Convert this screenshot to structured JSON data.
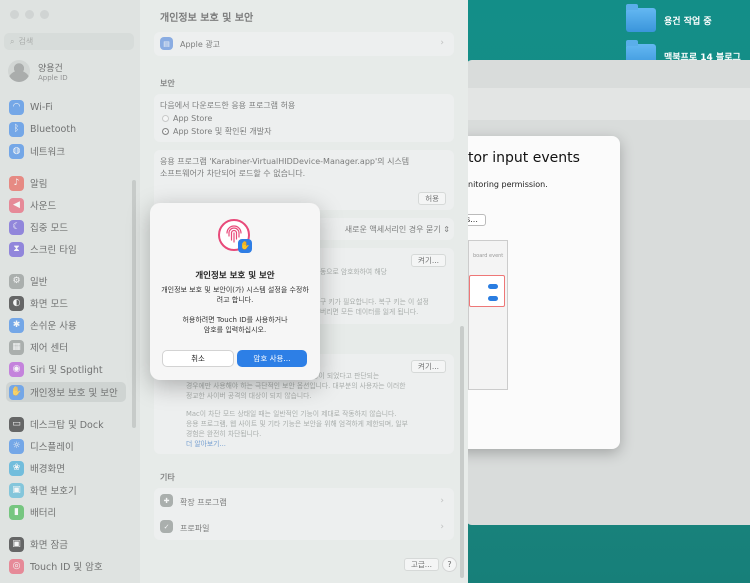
{
  "desktop": {
    "folders": [
      {
        "label": "용건 작업 중"
      },
      {
        "label": "맥북프로 14 블로그"
      }
    ]
  },
  "bg_dialog": {
    "title": "tor input events",
    "subtitle": "nitoring permission.",
    "button": "s...",
    "image_text": "board event"
  },
  "window": {
    "title": "개인정보 보호 및 보안"
  },
  "sidebar": {
    "search_placeholder": "검색",
    "user": {
      "name": "양용건",
      "sub": "Apple ID"
    },
    "items": [
      {
        "label": "Wi-Fi",
        "icon": "wifi-icon",
        "color": "#3a86e8"
      },
      {
        "label": "Bluetooth",
        "icon": "bluetooth-icon",
        "color": "#3a86e8"
      },
      {
        "label": "네트워크",
        "icon": "globe-icon",
        "color": "#3a86e8"
      },
      {
        "label": "알림",
        "icon": "bell-icon",
        "color": "#e85a4f"
      },
      {
        "label": "사운드",
        "icon": "speaker-icon",
        "color": "#e85a6f"
      },
      {
        "label": "집중 모드",
        "icon": "moon-icon",
        "color": "#6654d6"
      },
      {
        "label": "스크린 타임",
        "icon": "hourglass-icon",
        "color": "#6654d6"
      },
      {
        "label": "일반",
        "icon": "gear-icon",
        "color": "#8d9290"
      },
      {
        "label": "화면 모드",
        "icon": "appearance-icon",
        "color": "#222222"
      },
      {
        "label": "손쉬운 사용",
        "icon": "accessibility-icon",
        "color": "#3a86e8"
      },
      {
        "label": "제어 센터",
        "icon": "control-center-icon",
        "color": "#8d9290"
      },
      {
        "label": "Siri 및 Spotlight",
        "icon": "siri-icon",
        "color": "#b44fd8"
      },
      {
        "label": "개인정보 보호 및 보안",
        "icon": "hand-icon",
        "color": "#3a86e8"
      },
      {
        "label": "데스크탑 및 Dock",
        "icon": "dock-icon",
        "color": "#222222"
      },
      {
        "label": "디스플레이",
        "icon": "display-icon",
        "color": "#3a86e8"
      },
      {
        "label": "배경화면",
        "icon": "wallpaper-icon",
        "color": "#37a8d8"
      },
      {
        "label": "화면 보호기",
        "icon": "screensaver-icon",
        "color": "#52b6d6"
      },
      {
        "label": "배터리",
        "icon": "battery-icon",
        "color": "#3cb54a"
      },
      {
        "label": "화면 잠금",
        "icon": "lock-icon",
        "color": "#222222"
      },
      {
        "label": "Touch ID 및 암호",
        "icon": "fingerprint-icon",
        "color": "#e85a6f"
      }
    ]
  },
  "main": {
    "apple_ads": "Apple 광고",
    "security_header": "보안",
    "allow_apps_title": "다음에서 다운로드한 응용 프로그램 허용",
    "radio_1": "App Store",
    "radio_2": "App Store 및 확인된 개발자",
    "blocked_line1": "응용 프로그램 'Karabiner-VirtualHIDDevice-Manager.app'의 시스템",
    "blocked_line2": "소프트웨어가 차단되어 로드할 수 없습니다.",
    "allow_button": "허용",
    "accessory_select": "새로운 액세서리인 경우 묻기",
    "setting_button_1": "켜기...",
    "faded_1": "동으로 암호화하여 해당",
    "faded_2": "구 키가 필요합니다. 복구 키는 이 설정",
    "faded_3": "버리면 모든 데이터를 잃게 됩니다.",
    "setting_button_2": "켜기...",
    "lockdown_1": "대상이 되었다고 판단되는",
    "lockdown_2": "경우에만 사용해야 하는 극단적인 보안 옵션입니다. 대부분의 사용자는 이러한",
    "lockdown_3": "정교한 사이버 공격의 대상이 되지 않습니다.",
    "lockdown_4": "Mac이 차단 모드 상태일 때는 일반적인 기능이 제대로 작동하지 않습니다.",
    "lockdown_5": "응용 프로그램, 웹 사이트 및 기타 기능은 보안을 위해 엄격하게 제한되며, 일부",
    "lockdown_6": "경험은 완전히 차단됩니다.",
    "learn_more": "더 알아보기...",
    "other_header": "기타",
    "extensions": "확장 프로그램",
    "profiles": "프로파일",
    "advanced_button": "고급...",
    "help_button": "?"
  },
  "auth": {
    "title": "개인정보 보호 및 보안",
    "message_1": "개인정보 보호 및 보안이(가) 시스템 설정을 수정하",
    "message_2": "려고 합니다.",
    "message_3": "허용하려면 Touch ID를 사용하거나",
    "message_4": "암호를 입력하십시오.",
    "cancel": "취소",
    "use_password": "암호 사용..."
  }
}
